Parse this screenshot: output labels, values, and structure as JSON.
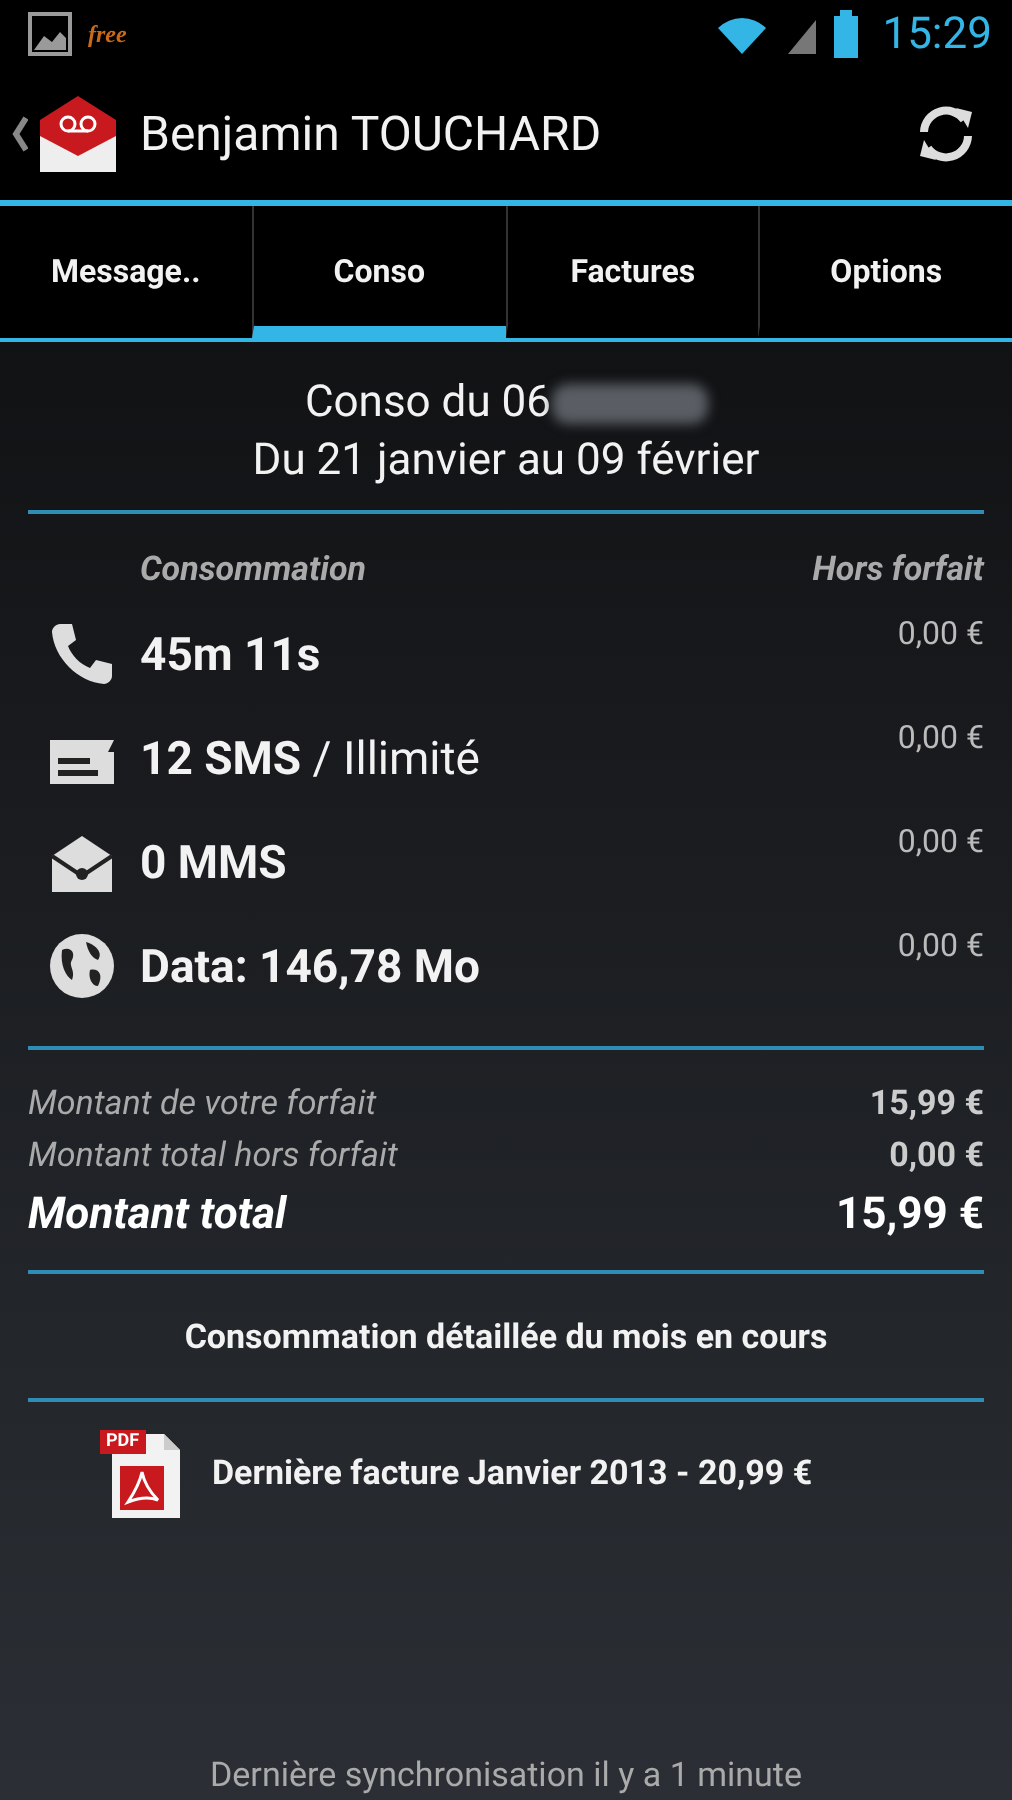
{
  "status_bar": {
    "notification": "free",
    "time": "15:29"
  },
  "action_bar": {
    "title": "Benjamin TOUCHARD"
  },
  "tabs": [
    {
      "label": "Message..",
      "selected": false
    },
    {
      "label": "Conso",
      "selected": true
    },
    {
      "label": "Factures",
      "selected": false
    },
    {
      "label": "Options",
      "selected": false
    }
  ],
  "header": {
    "line_1": "Conso du 06",
    "line_2": "Du 21 janvier au 09 février"
  },
  "usage": {
    "column_1": "Consommation",
    "column_2": "Hors forfait",
    "rows": [
      {
        "kind": "call",
        "value": "45m 11s",
        "extra": "0,00 €"
      },
      {
        "kind": "sms",
        "value": "12 SMS",
        "suffix": " / Illimité",
        "extra": "0,00 €"
      },
      {
        "kind": "mms",
        "value": "0 MMS",
        "extra": "0,00 €"
      },
      {
        "kind": "data",
        "value": "Data: 146,78 Mo",
        "extra": "0,00 €"
      }
    ]
  },
  "totals": [
    {
      "label": "Montant de votre forfait",
      "value": "15,99 €",
      "main": false
    },
    {
      "label": "Montant total hors forfait",
      "value": "0,00 €",
      "main": false
    },
    {
      "label": "Montant total",
      "value": "15,99 €",
      "main": true
    }
  ],
  "detail_link": "Consommation détaillée du mois en cours",
  "invoice": {
    "pdf_label": "PDF",
    "label": "Dernière facture Janvier 2013 - 20,99 €"
  },
  "footer": "Dernière synchronisation il y a 1 minute"
}
